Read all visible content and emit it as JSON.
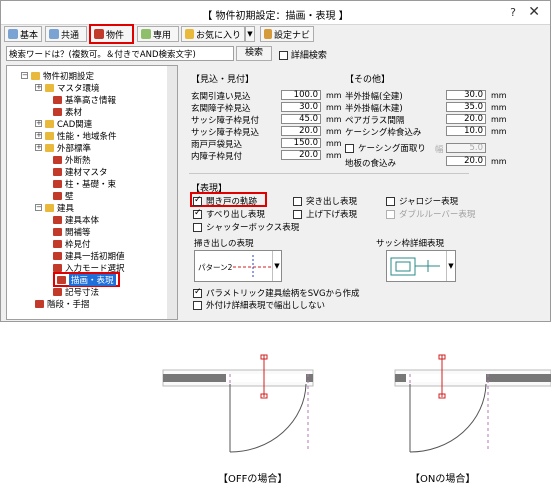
{
  "window": {
    "title": "【 物件初期設定：描画・表現 】",
    "help": "?",
    "close": "✕"
  },
  "toolbar": {
    "basic": "基本",
    "shared": "共通",
    "property": "物件",
    "exclusive": "専用",
    "favorites": "お気に入り",
    "settings_navi": "設定ナビ"
  },
  "search": {
    "placeholder": "検索ワードは？(複数可。＆付きでAND検索文字)",
    "button": "検索",
    "detail_label": "詳細検索"
  },
  "tree": {
    "items": [
      {
        "label": "物件初期設定",
        "exp": "−"
      },
      {
        "label": "マスタ環境",
        "exp": "+"
      },
      {
        "label": "基準高さ情報",
        "exp": ""
      },
      {
        "label": "素材",
        "exp": ""
      },
      {
        "label": "CAD関連",
        "exp": "+"
      },
      {
        "label": "性能・地域条件",
        "exp": "+"
      },
      {
        "label": "外部標準",
        "exp": "+"
      },
      {
        "label": "外断熱",
        "exp": ""
      },
      {
        "label": "建材マスタ",
        "exp": ""
      },
      {
        "label": "柱・基礎・束",
        "exp": ""
      },
      {
        "label": "壁",
        "exp": ""
      },
      {
        "label": "建具",
        "exp": "−"
      },
      {
        "label": "建具本体",
        "exp": ""
      },
      {
        "label": "開補等",
        "exp": ""
      },
      {
        "label": "枠見付",
        "exp": ""
      },
      {
        "label": "建具一括初期値",
        "exp": ""
      },
      {
        "label": "入力モード選択",
        "exp": ""
      },
      {
        "label": "描画・表現",
        "exp": ""
      },
      {
        "label": "記号寸法",
        "exp": ""
      },
      {
        "label": "階段・手摺",
        "exp": ""
      }
    ]
  },
  "mikake": {
    "title": "【見込・見付】",
    "unit": "mm",
    "rows": [
      {
        "label": "玄関引違い見込",
        "value": "100.0"
      },
      {
        "label": "玄関障子枠見込",
        "value": "30.0"
      },
      {
        "label": "サッシ障子枠見付",
        "value": "45.0"
      },
      {
        "label": "サッシ障子枠見込",
        "value": "20.0"
      },
      {
        "label": "雨戸戸袋見込",
        "value": "150.0"
      },
      {
        "label": "内障子枠見付",
        "value": "20.0"
      }
    ]
  },
  "other": {
    "title": "【その他】",
    "unit": "mm",
    "rows": [
      {
        "label": "半外掛幅(全建)",
        "value": "30.0"
      },
      {
        "label": "半外掛幅(木建)",
        "value": "35.0"
      },
      {
        "label": "ペアガラス間隔",
        "value": "20.0"
      },
      {
        "label": "ケーシング枠食込み",
        "value": "10.0"
      }
    ],
    "casing_check": "ケーシング面取り",
    "width_label": "幅",
    "width_value": "5.0",
    "floor_label": "地板の食込み",
    "floor_value": "20.0"
  },
  "hyogen": {
    "title": "【表現】",
    "checks": [
      {
        "label": "開き戸の軌跡",
        "checked": true,
        "disabled": false
      },
      {
        "label": "突き出し表現",
        "checked": false,
        "disabled": false
      },
      {
        "label": "ジャロジー表現",
        "checked": false,
        "disabled": false
      },
      {
        "label": "すべり出し表現",
        "checked": true,
        "disabled": false
      },
      {
        "label": "上げ下げ表現",
        "checked": false,
        "disabled": false
      },
      {
        "label": "ダブルルーバー表現",
        "checked": false,
        "disabled": true
      },
      {
        "label": "シャッターボックス表現",
        "checked": false,
        "disabled": false
      }
    ],
    "hakidashi_label": "掃き出しの表現",
    "hakidashi_value": "パターン2",
    "sash_label": "サッシ枠詳細表現",
    "bottom_checks": [
      {
        "label": "パラメトリック建具絵柄をSVGから作成",
        "checked": true
      },
      {
        "label": "外付け詳細表現で幅出ししない",
        "checked": false
      }
    ]
  },
  "captions": {
    "off": "【OFFの場合】",
    "on": "【ONの場合】"
  },
  "colors": {
    "highlight": "#e00000",
    "selection": "#1e6fd9",
    "door_red": "#d02020",
    "dashed_purple": "#b47ab4"
  }
}
